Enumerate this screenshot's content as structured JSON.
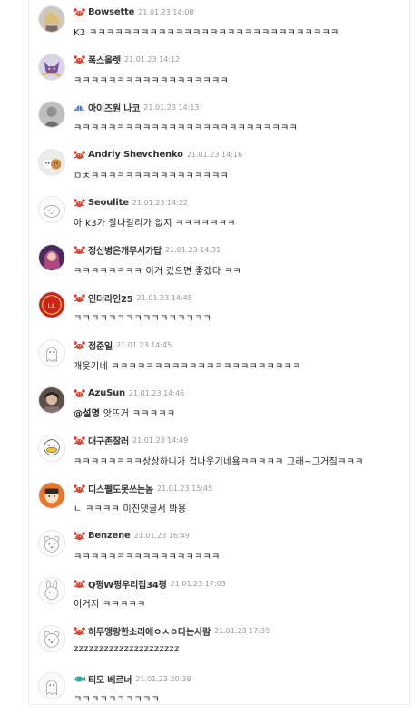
{
  "comments": [
    {
      "nick": "Bowsette",
      "date": "21.01.23 14:08",
      "badge": "crab",
      "text": "K3 ㅋㅋㅋㅋㅋㅋㅋㅋㅋㅋㅋㅋㅋㅋㅋㅋㅋㅋㅋㅋㅋㅋㅋㅋㅋㅋㅋㅋㅋ",
      "avatar": "photo-blonde"
    },
    {
      "nick": "폭스올렛",
      "date": "21.01.23 14:12",
      "badge": "crab",
      "text": "ㅋㅋㅋㅋㅋㅋㅋㅋㅋㅋㅋㅋㅋㅋㅋㅋㅋㅋ",
      "avatar": "purple-fox"
    },
    {
      "nick": "아이즈원 나코",
      "date": "21.01.23 14:13",
      "badge": "shell",
      "text": "ㅋㅋㅋㅋㅋㅋㅋㅋㅋㅋㅋㅋㅋㅋㅋㅋㅋㅋㅋㅋㅋㅋㅋㅋㅋㅋ",
      "avatar": "photo-gray"
    },
    {
      "nick": "Andriy Shevchenko",
      "date": "21.01.23 14:16",
      "badge": "crab",
      "text": "ㅁㅊㅋㅋㅋㅋㅋㅋㅋㅋㅋㅋㅋㅋㅋㅋㅋㅋ",
      "avatar": "dogs"
    },
    {
      "nick": "Seoulite",
      "date": "21.01.23 14:22",
      "badge": "crab",
      "text": "아 k3가 잘나갈리가 없지 ㅋㅋㅋㅋㅋㅋㅋ",
      "avatar": "default-bun"
    },
    {
      "nick": "정신병은개무시가답",
      "date": "21.01.23 14:31",
      "badge": "crab",
      "text": "ㅋㅋㅋㅋㅋㅋㅋㅋ 이거 갔으면 좋겠다 ㅋㅋ",
      "avatar": "photo-purple"
    },
    {
      "nick": "인더라인25",
      "date": "21.01.23 14:45",
      "badge": "crab",
      "text": "ㅋㅋㅋㅋㅋㅋㅋㅋㅋㅋㅋㅋㅋㅋㅋㅋ",
      "avatar": "red-logo"
    },
    {
      "nick": "정준일",
      "date": "21.01.23 14:45",
      "badge": "crab",
      "text": "개웃기네 ㅋㅋㅋㅋㅋㅋㅋㅋㅋㅋㅋㅋㅋㅋㅋㅋㅋㅋㅋㅋㅋㅋ",
      "avatar": "default-ghost"
    },
    {
      "nick": "AzuSun",
      "date": "21.01.23 14:46",
      "badge": "crab",
      "mention": "@설명",
      "text": " 앗뜨거 ㅋㅋㅋㅋㅋ",
      "avatar": "photo-dark"
    },
    {
      "nick": "대구존잘러",
      "date": "21.01.23 14:49",
      "badge": "crab",
      "text": "ㅋㅋㅋㅋㅋㅋㅋㅋ상상하니가 겁나웃기네욬ㅋㅋㅋㅋㅋ 그래~그거짘ㅋㅋㅋ",
      "avatar": "duck"
    },
    {
      "nick": "디스펠도못쓰는놈",
      "date": "21.01.23 15:45",
      "badge": "crab",
      "text": "ㄴ ㅋㅋㅋㅋ 미친댓글서 봐용",
      "avatar": "orange-face"
    },
    {
      "nick": "Benzene",
      "date": "21.01.23 16:49",
      "badge": "crab",
      "text": "ㅋㅋㅋㅋㅋㅋㅋㅋㅋㅋㅋㅋㅋㅋㅋㅋㅋ",
      "avatar": "default-bear"
    },
    {
      "nick": "Q평W평우리집34평",
      "date": "21.01.23 17:03",
      "badge": "crab",
      "text": "이거지 ㅋㅋㅋㅋㅋ",
      "avatar": "default-rabbit"
    },
    {
      "nick": "허무맹랑한소리에ㅇㅅㅇ다는사람",
      "date": "21.01.23 17:39",
      "badge": "crab",
      "text": "zzzzzzzzzzzzzzzzzzzzz",
      "avatar": "default-bear"
    },
    {
      "nick": "티모 베르너",
      "date": "21.01.23 20:38",
      "badge": "fish",
      "text": "ㅋㅋㅋㅋㅋㅋㅋㅋㅋㅋ",
      "avatar": "default-ghost"
    }
  ],
  "colors": {
    "crab": "#d9412f",
    "shell": "#3f7ac9",
    "fish": "#2ba8a0",
    "nick": "#333333",
    "date": "#9a9a9a"
  }
}
